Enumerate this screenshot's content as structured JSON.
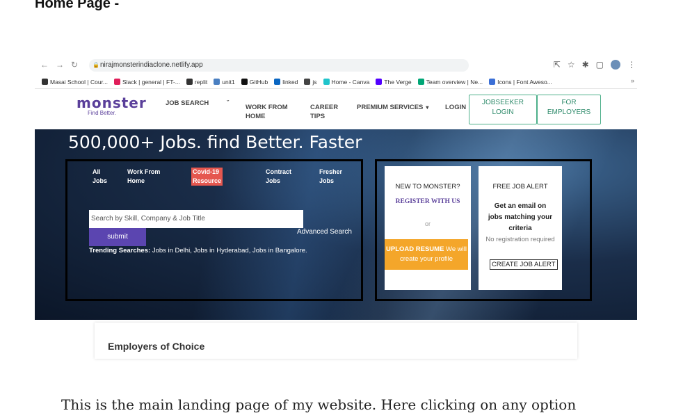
{
  "page": {
    "heading": "Home Page -",
    "caption": "This is the main landing page of my website. Here clicking on any option"
  },
  "browser": {
    "url": "nirajmonsterindiaclone.netlify.app",
    "bookmarks": [
      {
        "label": "Masai School | Cour...",
        "icon": "masai-icon",
        "color": "#333333"
      },
      {
        "label": "Slack | general | FT-...",
        "icon": "slack-icon",
        "color": "#e01e5a"
      },
      {
        "label": "replit",
        "icon": "replit-icon",
        "color": "#333333"
      },
      {
        "label": "unit1",
        "icon": "pen-icon",
        "color": "#4a7fc1"
      },
      {
        "label": "GitHub",
        "icon": "github-icon",
        "color": "#111111"
      },
      {
        "label": "linked",
        "icon": "linkedin-icon",
        "color": "#0a66c2"
      },
      {
        "label": "js",
        "icon": "js-icon",
        "color": "#444444"
      },
      {
        "label": "Home - Canva",
        "icon": "canva-icon",
        "color": "#20c4cb"
      },
      {
        "label": "The Verge",
        "icon": "verge-icon",
        "color": "#5200ff"
      },
      {
        "label": "Team overview | Ne...",
        "icon": "diamond-icon",
        "color": "#00a676"
      },
      {
        "label": "Icons | Font Aweso...",
        "icon": "flag-icon",
        "color": "#3b6fd6"
      }
    ]
  },
  "header": {
    "logo_word": "monster",
    "logo_tag": "Find Better.",
    "nav": {
      "job_search": "JOB SEARCH",
      "work_from_home_1": "WORK FROM",
      "work_from_home_2": "HOME",
      "career_tips_1": "CAREER",
      "career_tips_2": "TIPS",
      "premium": "PREMIUM SERVICES",
      "login": "LOGIN"
    },
    "jobseeker_1": "JOBSEEKER",
    "jobseeker_2": "LOGIN",
    "employers_1": "FOR",
    "employers_2": "EMPLOYERS"
  },
  "hero": {
    "title": "500,000+ Jobs. find Better. Faster",
    "tabs": [
      {
        "l1": "All",
        "l2": "Jobs"
      },
      {
        "l1": "Work From",
        "l2": "Home"
      },
      {
        "l1": "Covid-19",
        "l2": "Resource"
      },
      {
        "l1": "Contract",
        "l2": "Jobs"
      },
      {
        "l1": "Fresher",
        "l2": "Jobs"
      }
    ],
    "search_placeholder": "Search by Skill, Company & Job Title",
    "advanced": "Advanced Search",
    "submit": "submit",
    "trending_label": "Trending Searches:",
    "trending_items": "Jobs in Delhi, Jobs in Hyderabad, Jobs in Bangalore."
  },
  "cards": {
    "new_title": "NEW TO MONSTER?",
    "register": "REGISTER WITH US",
    "or": "or",
    "upload_bold": "UPLOAD RESUME",
    "upload_rest": " We will create your profile",
    "alert_title": "FREE JOB ALERT",
    "alert_l1": "Get an email on",
    "alert_l2": "jobs matching your",
    "alert_l3": "criteria",
    "no_reg": "No registration required",
    "create_alert": "CREATE JOB ALERT"
  },
  "employers": {
    "title": "Employers of Choice"
  }
}
